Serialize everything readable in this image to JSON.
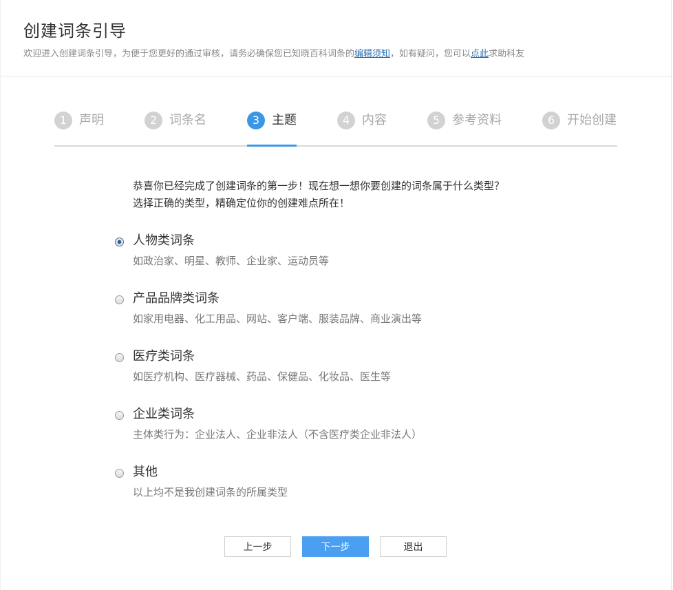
{
  "header": {
    "title": "创建词条引导",
    "subtitle_prefix": "欢迎进入创建词条引导，为便于您更好的通过审核，请务必确保您已知晓百科词条的",
    "subtitle_link1": "编辑须知",
    "subtitle_middle": "，如有疑问，您可以",
    "subtitle_link2": "点此",
    "subtitle_suffix": "求助科友"
  },
  "steps": [
    {
      "num": "1",
      "label": "声明",
      "active": false
    },
    {
      "num": "2",
      "label": "词条名",
      "active": false
    },
    {
      "num": "3",
      "label": "主题",
      "active": true
    },
    {
      "num": "4",
      "label": "内容",
      "active": false
    },
    {
      "num": "5",
      "label": "参考资料",
      "active": false
    },
    {
      "num": "6",
      "label": "开始创建",
      "active": false
    }
  ],
  "intro": {
    "line1": "恭喜你已经完成了创建词条的第一步！现在想一想你要创建的词条属于什么类型？",
    "line2": "选择正确的类型，精确定位你的创建难点所在！"
  },
  "options": [
    {
      "title": "人物类词条",
      "desc": "如政治家、明星、教师、企业家、运动员等",
      "checked": true
    },
    {
      "title": "产品品牌类词条",
      "desc": "如家用电器、化工用品、网站、客户端、服装品牌、商业演出等",
      "checked": false
    },
    {
      "title": "医疗类词条",
      "desc": "如医疗机构、医疗器械、药品、保健品、化妆品、医生等",
      "checked": false
    },
    {
      "title": "企业类词条",
      "desc": "主体类行为：企业法人、企业非法人（不含医疗类企业非法人）",
      "checked": false
    },
    {
      "title": "其他",
      "desc": "以上均不是我创建词条的所属类型",
      "checked": false
    }
  ],
  "buttons": {
    "prev": "上一步",
    "next": "下一步",
    "exit": "退出"
  },
  "colors": {
    "accent": "#3c96e6",
    "primary_button": "#4a9ff0",
    "link": "#2a6fb0",
    "inactive_step": "#d2d2d2"
  }
}
